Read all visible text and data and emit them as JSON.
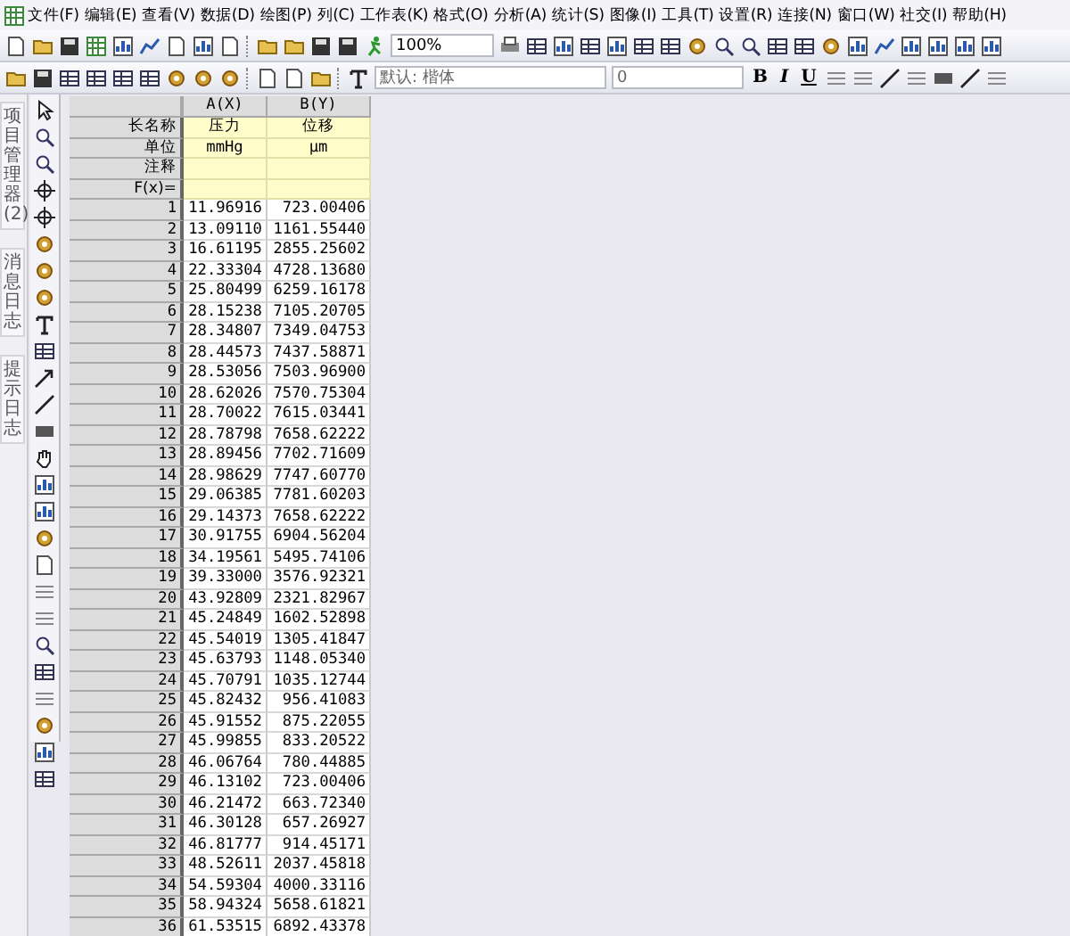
{
  "menu_bar": {
    "items": [
      "文件(F)",
      "编辑(E)",
      "查看(V)",
      "数据(D)",
      "绘图(P)",
      "列(C)",
      "工作表(K)",
      "格式(O)",
      "分析(A)",
      "统计(S)",
      "图像(I)",
      "工具(T)",
      "设置(R)",
      "连接(N)",
      "窗口(W)",
      "社交(I)",
      "帮助(H)"
    ]
  },
  "standard_toolbar": {
    "zoom": "100%"
  },
  "format_toolbar": {
    "font": "默认: 楷体",
    "font_size": "0",
    "style_buttons": [
      "B",
      "I",
      "U"
    ]
  },
  "side_tabs": [
    {
      "label": "项目管理器(2)"
    },
    {
      "label": "消息日志"
    },
    {
      "label": "提示日志"
    }
  ],
  "worksheet": {
    "columns": [
      {
        "label": "A(X)"
      },
      {
        "label": "B(Y)"
      }
    ],
    "header_rows": [
      {
        "label": "长名称",
        "values": [
          "压力",
          "位移"
        ]
      },
      {
        "label": "单位",
        "values": [
          "mmHg",
          "µm"
        ]
      },
      {
        "label": "注释"
      },
      {
        "label": "F(x)="
      }
    ],
    "rows": [
      {
        "index": "1",
        "values": [
          "11.96916",
          "723.00406"
        ]
      },
      {
        "index": "2",
        "values": [
          "13.09110",
          "1161.55440"
        ]
      },
      {
        "index": "3",
        "values": [
          "16.61195",
          "2855.25602"
        ]
      },
      {
        "index": "4",
        "values": [
          "22.33304",
          "4728.13680"
        ]
      },
      {
        "index": "5",
        "values": [
          "25.80499",
          "6259.16178"
        ]
      },
      {
        "index": "6",
        "values": [
          "28.15238",
          "7105.20705"
        ]
      },
      {
        "index": "7",
        "values": [
          "28.34807",
          "7349.04753"
        ]
      },
      {
        "index": "8",
        "values": [
          "28.44573",
          "7437.58871"
        ]
      },
      {
        "index": "9",
        "values": [
          "28.53056",
          "7503.96900"
        ]
      },
      {
        "index": "10",
        "values": [
          "28.62026",
          "7570.75304"
        ]
      },
      {
        "index": "11",
        "values": [
          "28.70022",
          "7615.03441"
        ]
      },
      {
        "index": "12",
        "values": [
          "28.78798",
          "7658.62222"
        ]
      },
      {
        "index": "13",
        "values": [
          "28.89456",
          "7702.71609"
        ]
      },
      {
        "index": "14",
        "values": [
          "28.98629",
          "7747.60770"
        ]
      },
      {
        "index": "15",
        "values": [
          "29.06385",
          "7781.60203"
        ]
      },
      {
        "index": "16",
        "values": [
          "29.14373",
          "7658.62222"
        ]
      },
      {
        "index": "17",
        "values": [
          "30.91755",
          "6904.56204"
        ]
      },
      {
        "index": "18",
        "values": [
          "34.19561",
          "5495.74106"
        ]
      },
      {
        "index": "19",
        "values": [
          "39.33000",
          "3576.92321"
        ]
      },
      {
        "index": "20",
        "values": [
          "43.92809",
          "2321.82967"
        ]
      },
      {
        "index": "21",
        "values": [
          "45.24849",
          "1602.52898"
        ]
      },
      {
        "index": "22",
        "values": [
          "45.54019",
          "1305.41847"
        ]
      },
      {
        "index": "23",
        "values": [
          "45.63793",
          "1148.05340"
        ]
      },
      {
        "index": "24",
        "values": [
          "45.70791",
          "1035.12744"
        ]
      },
      {
        "index": "25",
        "values": [
          "45.82432",
          "956.41083"
        ]
      },
      {
        "index": "26",
        "values": [
          "45.91552",
          "875.22055"
        ]
      },
      {
        "index": "27",
        "values": [
          "45.99855",
          "833.20522"
        ]
      },
      {
        "index": "28",
        "values": [
          "46.06764",
          "780.44885"
        ]
      },
      {
        "index": "29",
        "values": [
          "46.13102",
          "723.00406"
        ]
      },
      {
        "index": "30",
        "values": [
          "46.21472",
          "663.72340"
        ]
      },
      {
        "index": "31",
        "values": [
          "46.30128",
          "657.26927"
        ]
      },
      {
        "index": "32",
        "values": [
          "46.81777",
          "914.45171"
        ]
      },
      {
        "index": "33",
        "values": [
          "48.52611",
          "2037.45818"
        ]
      },
      {
        "index": "34",
        "values": [
          "54.59304",
          "4000.33116"
        ]
      },
      {
        "index": "35",
        "values": [
          "58.94324",
          "5658.61821"
        ]
      },
      {
        "index": "36",
        "values": [
          "61.53515",
          "6892.43378"
        ]
      }
    ]
  }
}
